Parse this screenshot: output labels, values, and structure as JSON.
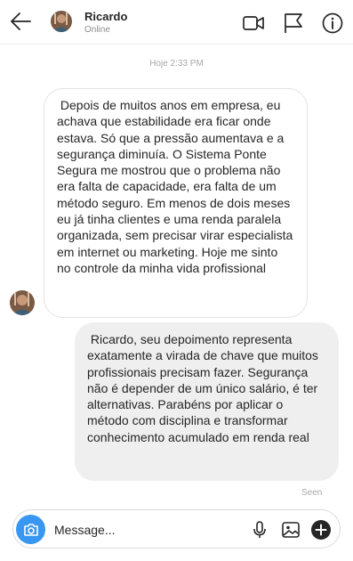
{
  "header": {
    "contact_name": "Ricardo",
    "status": "Online"
  },
  "conversation": {
    "timestamp": "Hoje 2:33 PM",
    "messages": [
      {
        "direction": "incoming",
        "text": " Depois de muitos anos em empresa, eu achava que estabilidade era ficar onde estava. Só que a pressão aumentava e a segurança diminuía. O Sistema Ponte Segura me mostrou que o problema não era falta de capacidade, era falta de um método seguro. Em menos de dois meses eu já tinha clientes e uma renda paralela organizada, sem precisar virar especialista em internet ou marketing. Hoje me sinto no controle da minha vida profissional"
      },
      {
        "direction": "outgoing",
        "text": " Ricardo, seu depoimento representa exatamente a virada de chave que muitos profissionais precisam fazer. Segurança não é depender de um único salário, é ter alternativas. Parabéns por aplicar o método com disciplina e transformar conhecimento acumulado em renda real"
      }
    ],
    "seen_label": "Seen"
  },
  "composer": {
    "placeholder": "Message..."
  },
  "icons": {
    "back": "arrow-left-icon",
    "video": "video-camera-icon",
    "flag": "flag-icon",
    "info": "info-icon",
    "camera": "camera-icon",
    "mic": "microphone-icon",
    "gallery": "image-icon",
    "add": "plus-circle-icon"
  },
  "colors": {
    "accent": "#3897f0",
    "outgoing_bubble": "#efefef",
    "incoming_border": "#e3e3e3",
    "muted_text": "#8e8e8e"
  }
}
